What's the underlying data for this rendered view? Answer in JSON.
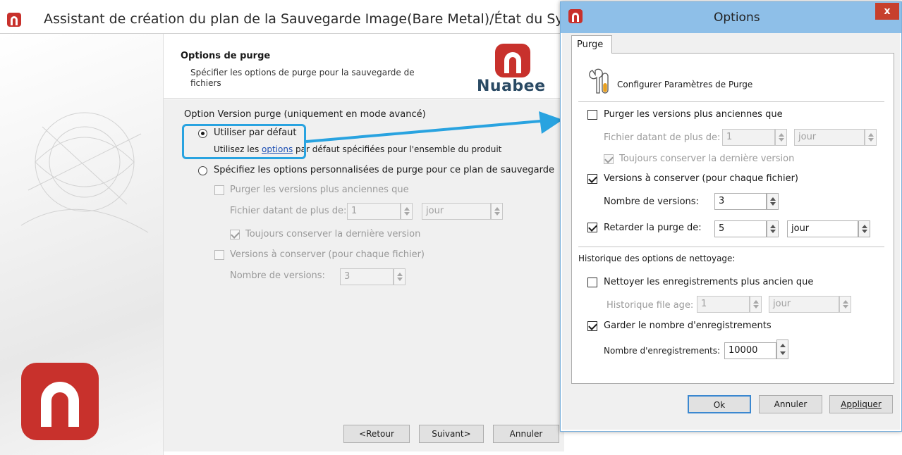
{
  "colors": {
    "brand": "#c8312c",
    "highlight": "#29a3e0",
    "link": "#1d4fb3",
    "dialog_title": "#8ebfe8"
  },
  "wizard": {
    "title": "Assistant de création du plan de la Sauvegarde Image(Bare Metal)/État du Système",
    "header_title": "Options de purge",
    "header_subtitle": "Spécifier les options de purge pour la sauvegarde de fichiers",
    "brand": "Nuabee",
    "group_label": "Option Version purge (uniquement en mode avancé)",
    "radio_default": {
      "label": "Utiliser par défaut",
      "selected": true
    },
    "default_desc": {
      "prefix": "Utilisez les ",
      "link": "options",
      "suffix": " par défaut spécifiées pour l'ensemble du produit"
    },
    "radio_custom": {
      "label": "Spécifiez les options personnalisées de purge pour ce plan de sauvegarde",
      "selected": false
    },
    "purge_older": {
      "label": "Purger les versions plus anciennes que",
      "checked": false
    },
    "file_older_label": "Fichier datant de plus de:",
    "file_older_value": "1",
    "file_older_unit": "jour",
    "keep_last": {
      "label": "Toujours conserver la dernière version",
      "checked": true
    },
    "versions_keep": {
      "label": "Versions à conserver (pour chaque fichier)",
      "checked": false
    },
    "num_versions_label": "Nombre de versions:",
    "num_versions_value": "3",
    "buttons": {
      "back": "<Retour",
      "next": "Suivant>",
      "cancel": "Annuler"
    }
  },
  "options": {
    "title": "Options",
    "close": "x",
    "tab": "Purge",
    "section_title": "Configurer Paramètres de Purge",
    "purge_older": {
      "label": "Purger les versions plus anciennes que",
      "checked": false
    },
    "file_older_label": "Fichier datant de plus de:",
    "file_older_value": "1",
    "file_older_unit": "jour",
    "keep_last": {
      "label": "Toujours conserver la dernière version",
      "checked": true
    },
    "versions_keep": {
      "label": "Versions à conserver (pour chaque fichier)",
      "checked": true
    },
    "num_versions_label": "Nombre de versions:",
    "num_versions_value": "3",
    "delay": {
      "label": "Retarder la purge de:",
      "checked": true,
      "value": "5",
      "unit": "jour"
    },
    "history_title": "Historique des options de nettoyage:",
    "clean_records": {
      "label": "Nettoyer les enregistrements plus ancien que",
      "checked": false
    },
    "history_age_label": "Historique file age:",
    "history_age_value": "1",
    "history_age_unit": "jour",
    "keep_count": {
      "label": "Garder le nombre d'enregistrements",
      "checked": true
    },
    "count_label": "Nombre d'enregistrements:",
    "count_value": "10000",
    "buttons": {
      "ok": "Ok",
      "cancel": "Annuler",
      "apply": "Appliquer"
    }
  }
}
